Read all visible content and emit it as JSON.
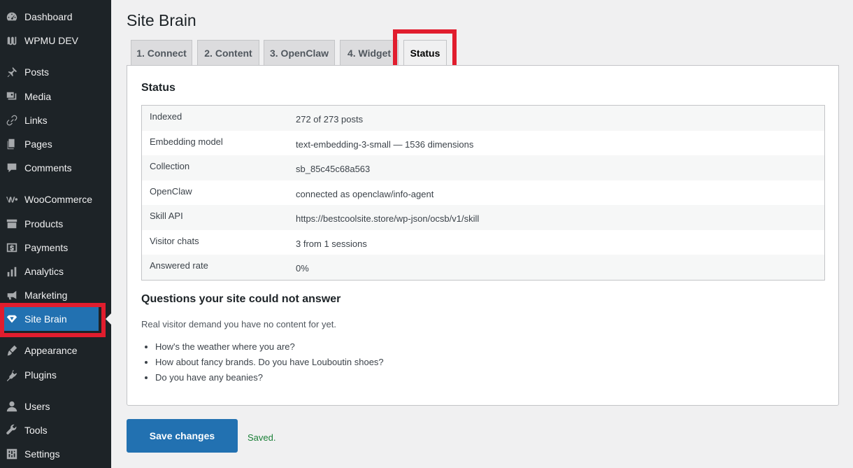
{
  "sidebar": {
    "items": [
      {
        "label": "Dashboard",
        "icon": "dashboard-icon"
      },
      {
        "label": "WPMU DEV",
        "icon": "wpmudev-icon"
      },
      {
        "label": "Posts",
        "icon": "pin-icon"
      },
      {
        "label": "Media",
        "icon": "media-icon"
      },
      {
        "label": "Links",
        "icon": "link-icon"
      },
      {
        "label": "Pages",
        "icon": "pages-icon"
      },
      {
        "label": "Comments",
        "icon": "comment-icon"
      },
      {
        "label": "WooCommerce",
        "icon": "woocommerce-icon"
      },
      {
        "label": "Products",
        "icon": "archive-icon"
      },
      {
        "label": "Payments",
        "icon": "payments-icon"
      },
      {
        "label": "Analytics",
        "icon": "chart-bar-icon"
      },
      {
        "label": "Marketing",
        "icon": "megaphone-icon"
      },
      {
        "label": "Site Brain",
        "icon": "diamond-icon",
        "active": true
      },
      {
        "label": "Appearance",
        "icon": "brush-icon"
      },
      {
        "label": "Plugins",
        "icon": "plugin-icon"
      },
      {
        "label": "Users",
        "icon": "user-icon"
      },
      {
        "label": "Tools",
        "icon": "wrench-icon"
      },
      {
        "label": "Settings",
        "icon": "settings-icon"
      }
    ]
  },
  "page": {
    "title": "Site Brain"
  },
  "tabs": [
    {
      "label": "1. Connect"
    },
    {
      "label": "2. Content"
    },
    {
      "label": "3. OpenClaw"
    },
    {
      "label": "4. Widget"
    },
    {
      "label": "Status",
      "active": true
    }
  ],
  "status": {
    "heading": "Status",
    "rows": [
      {
        "key": "Indexed",
        "value": "272 of 273 posts"
      },
      {
        "key": "Embedding model",
        "value": "text-embedding-3-small — 1536 dimensions"
      },
      {
        "key": "Collection",
        "value": "sb_85c45c68a563"
      },
      {
        "key": "OpenClaw",
        "value": "connected as openclaw/info-agent"
      },
      {
        "key": "Skill API",
        "value": "https://bestcoolsite.store/wp-json/ocsb/v1/skill"
      },
      {
        "key": "Visitor chats",
        "value": "3 from 1 sessions"
      },
      {
        "key": "Answered rate",
        "value": "0%"
      }
    ]
  },
  "unanswered": {
    "heading": "Questions your site could not answer",
    "description": "Real visitor demand you have no content for yet.",
    "items": [
      "How's the weather where you are?",
      "How about fancy brands. Do you have Louboutin shoes?",
      "Do you have any beanies?"
    ]
  },
  "footer": {
    "save_label": "Save changes",
    "saved_message": "Saved."
  },
  "colors": {
    "sidebar_bg": "#1d2327",
    "accent": "#2271b1",
    "highlight": "#e11d2e",
    "success": "#1a7f37"
  }
}
